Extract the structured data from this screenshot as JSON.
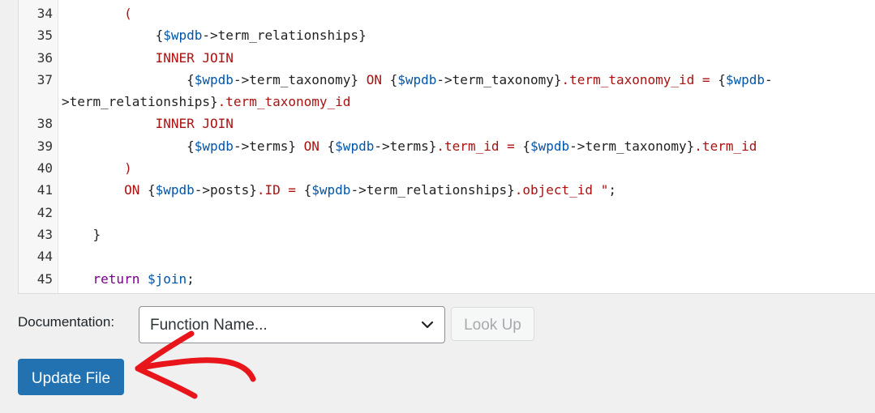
{
  "editor": {
    "lines": [
      {
        "num": "34",
        "segs": [
          {
            "t": "        "
          },
          {
            "t": "(",
            "c": "k"
          }
        ]
      },
      {
        "num": "35",
        "segs": [
          {
            "t": "            {"
          },
          {
            "t": "$wpdb",
            "c": "v"
          },
          {
            "t": "->term_relationships}"
          }
        ]
      },
      {
        "num": "36",
        "segs": [
          {
            "t": "            "
          },
          {
            "t": "INNER JOIN",
            "c": "k"
          }
        ]
      },
      {
        "num": "37",
        "segs": [
          {
            "t": "                {"
          },
          {
            "t": "$wpdb",
            "c": "v"
          },
          {
            "t": "->term_taxonomy} "
          },
          {
            "t": "ON",
            "c": "k"
          },
          {
            "t": " {"
          },
          {
            "t": "$wpdb",
            "c": "v"
          },
          {
            "t": "->term_taxonomy}"
          },
          {
            "t": ".term_taxonomy_id =",
            "c": "k"
          },
          {
            "t": " {"
          },
          {
            "t": "$wpdb",
            "c": "v"
          },
          {
            "t": "-"
          }
        ]
      },
      {
        "num": "",
        "segs": [
          {
            "t": ">term_relationships}"
          },
          {
            "t": ".term_taxonomy_id",
            "c": "k"
          }
        ]
      },
      {
        "num": "38",
        "segs": [
          {
            "t": "            "
          },
          {
            "t": "INNER JOIN",
            "c": "k"
          }
        ]
      },
      {
        "num": "39",
        "segs": [
          {
            "t": "                {"
          },
          {
            "t": "$wpdb",
            "c": "v"
          },
          {
            "t": "->terms} "
          },
          {
            "t": "ON",
            "c": "k"
          },
          {
            "t": " {"
          },
          {
            "t": "$wpdb",
            "c": "v"
          },
          {
            "t": "->terms}"
          },
          {
            "t": ".term_id =",
            "c": "k"
          },
          {
            "t": " {"
          },
          {
            "t": "$wpdb",
            "c": "v"
          },
          {
            "t": "->term_taxonomy}"
          },
          {
            "t": ".term_id",
            "c": "k"
          }
        ]
      },
      {
        "num": "40",
        "segs": [
          {
            "t": "        "
          },
          {
            "t": ")",
            "c": "k"
          }
        ]
      },
      {
        "num": "41",
        "segs": [
          {
            "t": "        "
          },
          {
            "t": "ON",
            "c": "k"
          },
          {
            "t": " {"
          },
          {
            "t": "$wpdb",
            "c": "v"
          },
          {
            "t": "->posts}"
          },
          {
            "t": ".ID =",
            "c": "k"
          },
          {
            "t": " {"
          },
          {
            "t": "$wpdb",
            "c": "v"
          },
          {
            "t": "->term_relationships}"
          },
          {
            "t": ".object_id \"",
            "c": "k"
          },
          {
            "t": ";"
          }
        ]
      },
      {
        "num": "42",
        "segs": [
          {
            "t": ""
          }
        ]
      },
      {
        "num": "43",
        "segs": [
          {
            "t": "    }"
          }
        ]
      },
      {
        "num": "44",
        "segs": [
          {
            "t": ""
          }
        ]
      },
      {
        "num": "45",
        "segs": [
          {
            "t": "    "
          },
          {
            "t": "return",
            "c": "r"
          },
          {
            "t": " "
          },
          {
            "t": "$join",
            "c": "v"
          },
          {
            "t": ";"
          }
        ]
      }
    ]
  },
  "documentation": {
    "label": "Documentation:",
    "select_value": "Function Name...",
    "lookup_label": "Look Up"
  },
  "update_button": {
    "label": "Update File"
  },
  "annotation": {
    "arrow_color": "#e8161b"
  },
  "icons": {
    "select_chevron": "chevron-down-icon",
    "arrow": "arrow-annotation-icon"
  }
}
